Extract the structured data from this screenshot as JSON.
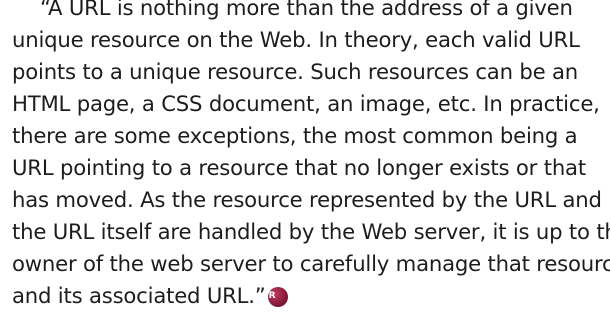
{
  "quote": {
    "lines": [
      "“A URL is nothing more than the address of a given",
      "unique resource on the Web. In theory, each valid URL",
      "points to a unique resource. Such resources can be an",
      "HTML page, a CSS document, an image, etc. In practice,",
      "there are some exceptions, the most common being a",
      "URL pointing to a resource that no longer exists or that",
      "has moved. As the resource represented by the URL and",
      "the URL itself are handled by the Web server, it is up to the",
      "owner of the web server to carefully manage that resource",
      "and its associated URL.”"
    ]
  },
  "attribution": {
    "avatar_text": "R",
    "avatar_color": "#7a1534"
  }
}
